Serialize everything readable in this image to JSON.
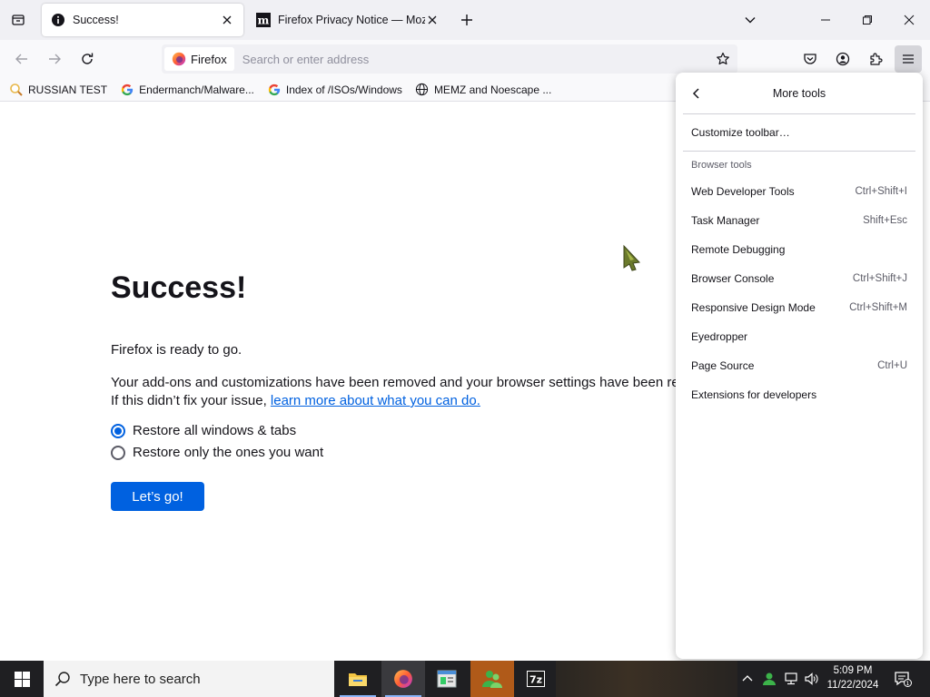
{
  "tabs": [
    {
      "title": "Success!",
      "icon": "info-icon",
      "active": true
    },
    {
      "title": "Firefox Privacy Notice — Mozill",
      "icon": "mozilla-m-icon",
      "active": false
    }
  ],
  "navbar": {
    "identity_label": "Firefox",
    "url_placeholder": "Search or enter address"
  },
  "bookmarks": [
    {
      "label": "RUSSIAN TEST",
      "icon": "magnifier-icon"
    },
    {
      "label": "Endermanch/Malware...",
      "icon": "google-icon"
    },
    {
      "label": "Index of /ISOs/Windows",
      "icon": "google-icon"
    },
    {
      "label": "MEMZ and Noescape ...",
      "icon": "globe-icon"
    }
  ],
  "page": {
    "title": "Success!",
    "ready": "Firefox is ready to go.",
    "desc_line1": "Your add-ons and customizations have been removed and your browser settings have been restored to their defaults.",
    "desc_line2_prefix": "If this didn’t fix your issue, ",
    "desc_link": "learn more about what you can do.",
    "options": [
      {
        "label": "Restore all windows & tabs",
        "checked": true
      },
      {
        "label": "Restore only the ones you want",
        "checked": false
      }
    ],
    "go_button": "Let’s go!"
  },
  "panel": {
    "title": "More tools",
    "customize": "Customize toolbar…",
    "section": "Browser tools",
    "items": [
      {
        "label": "Web Developer Tools",
        "shortcut": "Ctrl+Shift+I"
      },
      {
        "label": "Task Manager",
        "shortcut": "Shift+Esc"
      },
      {
        "label": "Remote Debugging",
        "shortcut": ""
      },
      {
        "label": "Browser Console",
        "shortcut": "Ctrl+Shift+J"
      },
      {
        "label": "Responsive Design Mode",
        "shortcut": "Ctrl+Shift+M"
      },
      {
        "label": "Eyedropper",
        "shortcut": ""
      },
      {
        "label": "Page Source",
        "shortcut": "Ctrl+U"
      },
      {
        "label": "Extensions for developers",
        "shortcut": ""
      }
    ]
  },
  "taskbar": {
    "search_placeholder": "Type here to search",
    "time": "5:09 PM",
    "date": "11/22/2024",
    "notification_count": "1"
  },
  "colors": {
    "accent": "#0061e0",
    "tabstrip": "#f0f0f4",
    "taskbar": "#1f1f22"
  }
}
